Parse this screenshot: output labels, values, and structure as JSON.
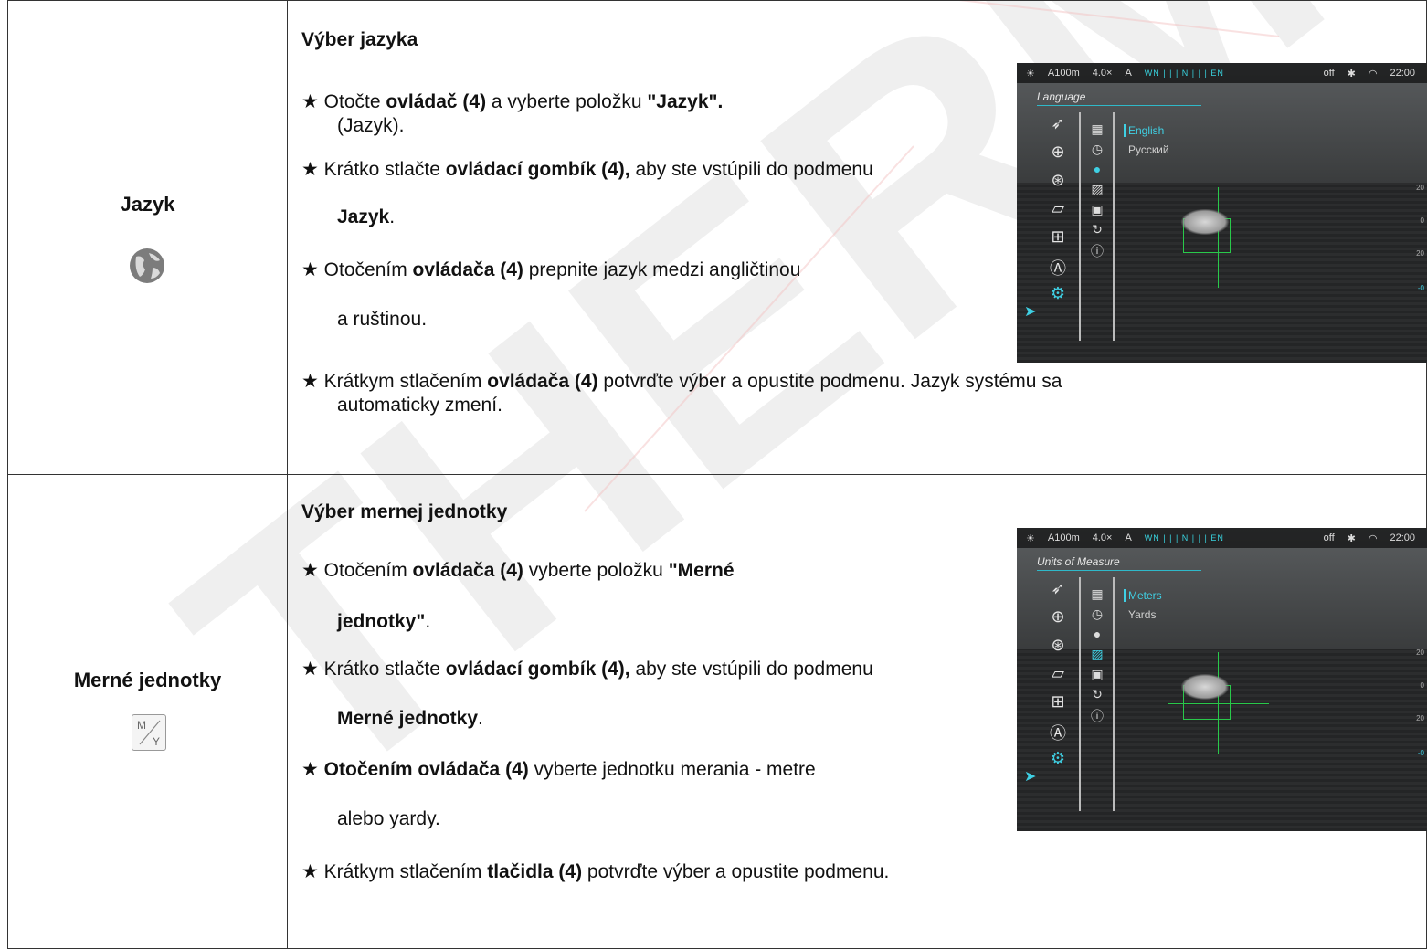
{
  "watermark": "THERMOFOX",
  "rows": [
    {
      "category": "Jazyk",
      "icon": "globe-icon",
      "title": "Výber jazyka",
      "lines": [
        [
          "★ Otočte ",
          "ovládač (4)",
          " a vyberte položku ",
          "\"Jazyk\"."
        ],
        [
          "(Jazyk)."
        ],
        [
          "★ Krátko stlačte ",
          "ovládací gombík (4),",
          " aby ste vstúpili do podmenu"
        ],
        [
          "Jazyk",
          "."
        ],
        [
          "★ Otočením ",
          "ovládača (4)",
          " prepnite jazyk medzi angličtinou"
        ],
        [
          "a ruštinou."
        ],
        [
          "★ Krátkym stlačením ",
          "ovládača (4)",
          " potvrďte výber a opustite podmenu. Jazyk systému sa"
        ],
        [
          "automaticky zmení."
        ]
      ],
      "screen": {
        "hud": {
          "mode": "A100m",
          "zoom": "4.0×",
          "a": "A",
          "compass": "WN | | | N | | | EN",
          "wifi": "off",
          "time": "22:00"
        },
        "menu_title": "Language",
        "options": [
          "English",
          "Русский"
        ]
      }
    },
    {
      "category": "Merné jednotky",
      "icon": "meters-yards-icon",
      "icon_text": "M/Y",
      "title": "Výber mernej jednotky",
      "lines": [
        [
          "★ Otočením ",
          "ovládača (4)",
          " vyberte položku ",
          "\"Merné"
        ],
        [
          "jednotky\"",
          "."
        ],
        [
          "★ Krátko stlačte ",
          "ovládací gombík (4),",
          " aby ste vstúpili do podmenu"
        ],
        [
          "Merné jednotky",
          "."
        ],
        [
          "★ ",
          "Otočením ovládača (4)",
          " vyberte jednotku merania - metre"
        ],
        [
          "alebo yardy."
        ],
        [
          "★ Krátkym stlačením ",
          "tlačidla (4)",
          " potvrďte výber a opustite podmenu."
        ]
      ],
      "screen": {
        "hud": {
          "mode": "A100m",
          "zoom": "4.0×",
          "a": "A",
          "compass": "WN | | | N | | | EN",
          "wifi": "off",
          "time": "22:00"
        },
        "menu_title": "Units of Measure",
        "options": [
          "Meters",
          "Yards"
        ]
      }
    }
  ],
  "side_ticks": [
    "20",
    "0",
    "20",
    "-0"
  ]
}
